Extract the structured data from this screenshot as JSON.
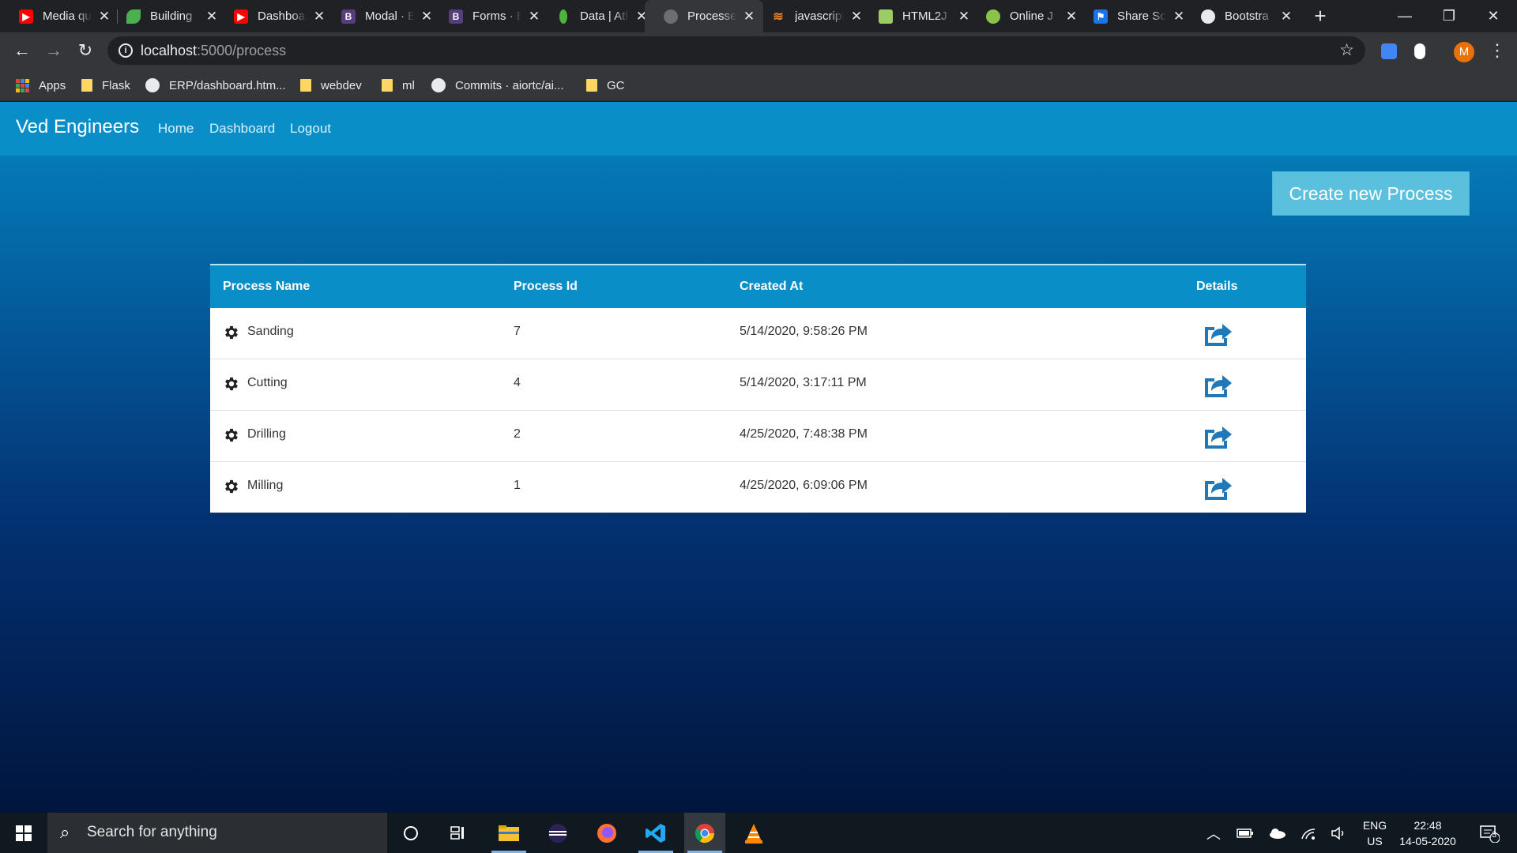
{
  "browser": {
    "tabs": [
      {
        "title": "Media queries",
        "favicon": "youtube-icon",
        "color": "#ff0000"
      },
      {
        "title": "Building",
        "favicon": "leaf-icon",
        "color": "#4caf50"
      },
      {
        "title": "Dashboard",
        "favicon": "youtube-icon",
        "color": "#ff0000"
      },
      {
        "title": "Modal · Bootstrap",
        "favicon": "bootstrap-icon",
        "color": "#563d7c"
      },
      {
        "title": "Forms · Bootstrap",
        "favicon": "bootstrap-icon",
        "color": "#563d7c"
      },
      {
        "title": "Data | Atlas",
        "favicon": "mongodb-leaf-icon",
        "color": "#4db33d"
      },
      {
        "title": "Processes",
        "favicon": "globe-icon",
        "color": "#9aa0a6",
        "active": true
      },
      {
        "title": "javascript",
        "favicon": "stackoverflow-icon",
        "color": "#f48024"
      },
      {
        "title": "HTML2J",
        "favicon": "page-icon",
        "color": "#9ccc65"
      },
      {
        "title": "Online J",
        "favicon": "online-icon",
        "color": "#8bc34a"
      },
      {
        "title": "Share Sc",
        "favicon": "flag-icon",
        "color": "#1a73e8"
      },
      {
        "title": "Bootstra",
        "favicon": "globe-icon",
        "color": "#e8eaed"
      }
    ],
    "new_tab_label": "+",
    "url_host": "localhost",
    "url_path": ":5000/process",
    "profile_initial": "M",
    "bookmarks": [
      {
        "label": "Apps",
        "icon": "apps-grid-icon"
      },
      {
        "label": "Flask",
        "icon": "folder-icon"
      },
      {
        "label": "ERP/dashboard.htm...",
        "icon": "github-icon"
      },
      {
        "label": "webdev",
        "icon": "folder-icon"
      },
      {
        "label": "ml",
        "icon": "folder-icon"
      },
      {
        "label": "Commits · aiortc/ai...",
        "icon": "github-icon"
      },
      {
        "label": "GC",
        "icon": "folder-icon"
      }
    ]
  },
  "app": {
    "brand": "Ved Engineers",
    "nav": [
      "Home",
      "Dashboard",
      "Logout"
    ],
    "create_button": "Create new Process",
    "table": {
      "headers": [
        "Process Name",
        "Process Id",
        "Created At",
        "Details"
      ],
      "rows": [
        {
          "name": "Sanding",
          "id": "7",
          "created": "5/14/2020, 9:58:26 PM"
        },
        {
          "name": "Cutting",
          "id": "4",
          "created": "5/14/2020, 3:17:11 PM"
        },
        {
          "name": "Drilling",
          "id": "2",
          "created": "4/25/2020, 7:48:38 PM"
        },
        {
          "name": "Milling",
          "id": "1",
          "created": "4/25/2020, 6:09:06 PM"
        }
      ]
    },
    "colors": {
      "navbar": "#0a8ec7",
      "button": "#5bc0de",
      "accent_icon": "#1f79b8"
    }
  },
  "taskbar": {
    "search_placeholder": "Search for anything",
    "apps": [
      "cortana-icon",
      "task-view-icon",
      "file-explorer-icon",
      "eclipse-icon",
      "firefox-icon",
      "vscode-icon",
      "chrome-icon",
      "vlc-icon"
    ],
    "lang_top": "ENG",
    "lang_bottom": "US",
    "time": "22:48",
    "date": "14-05-2020",
    "notification_count": "3"
  }
}
